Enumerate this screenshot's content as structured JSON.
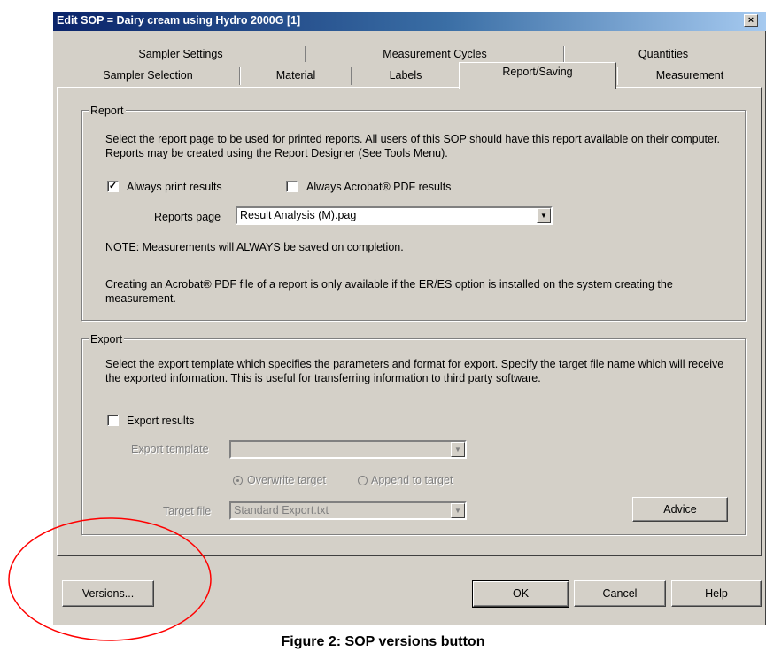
{
  "window": {
    "title": "Edit SOP = Dairy cream using Hydro 2000G [1]",
    "close_glyph": "×"
  },
  "tabs": {
    "back_row": [
      "Sampler Settings",
      "Measurement Cycles",
      "Quantities"
    ],
    "front_row": [
      "Sampler Selection",
      "Material",
      "Labels",
      "Report/Saving",
      "Measurement"
    ],
    "active": "Report/Saving"
  },
  "report": {
    "legend": "Report",
    "description": "Select the report page to be used for printed reports. All users of this SOP should have this report available on their computer. Reports may be created using the Report Designer (See Tools Menu).",
    "always_print_label": "Always print results",
    "always_print_checked": true,
    "always_pdf_label": "Always Acrobat® PDF results",
    "always_pdf_checked": false,
    "reports_page_label": "Reports page",
    "reports_page_value": "Result Analysis (M).pag",
    "note": "NOTE: Measurements will ALWAYS be saved on completion.",
    "pdf_note": "Creating an Acrobat® PDF file of a report is only available if the ER/ES option is installed on the system creating the measurement."
  },
  "export": {
    "legend": "Export",
    "description": "Select the export template which specifies the parameters and format for export. Specify the target file name which will receive the exported information. This is useful for transferring information to third party software.",
    "export_results_label": "Export results",
    "export_results_checked": false,
    "template_label": "Export template",
    "template_value": "",
    "overwrite_label": "Overwrite target",
    "append_label": "Append to target",
    "selected_mode": "Overwrite target",
    "target_file_label": "Target file",
    "target_file_value": "Standard Export.txt",
    "advice_label": "Advice"
  },
  "buttons": {
    "versions": "Versions...",
    "ok": "OK",
    "cancel": "Cancel",
    "help": "Help"
  },
  "caption": "Figure 2: SOP versions button",
  "colors": {
    "annotation_circle": "#ff0000",
    "dialog_face": "#d4d0c8",
    "title_gradient_start": "#0a246a"
  },
  "icons": {
    "check": "✓",
    "dropdown": "▼"
  }
}
